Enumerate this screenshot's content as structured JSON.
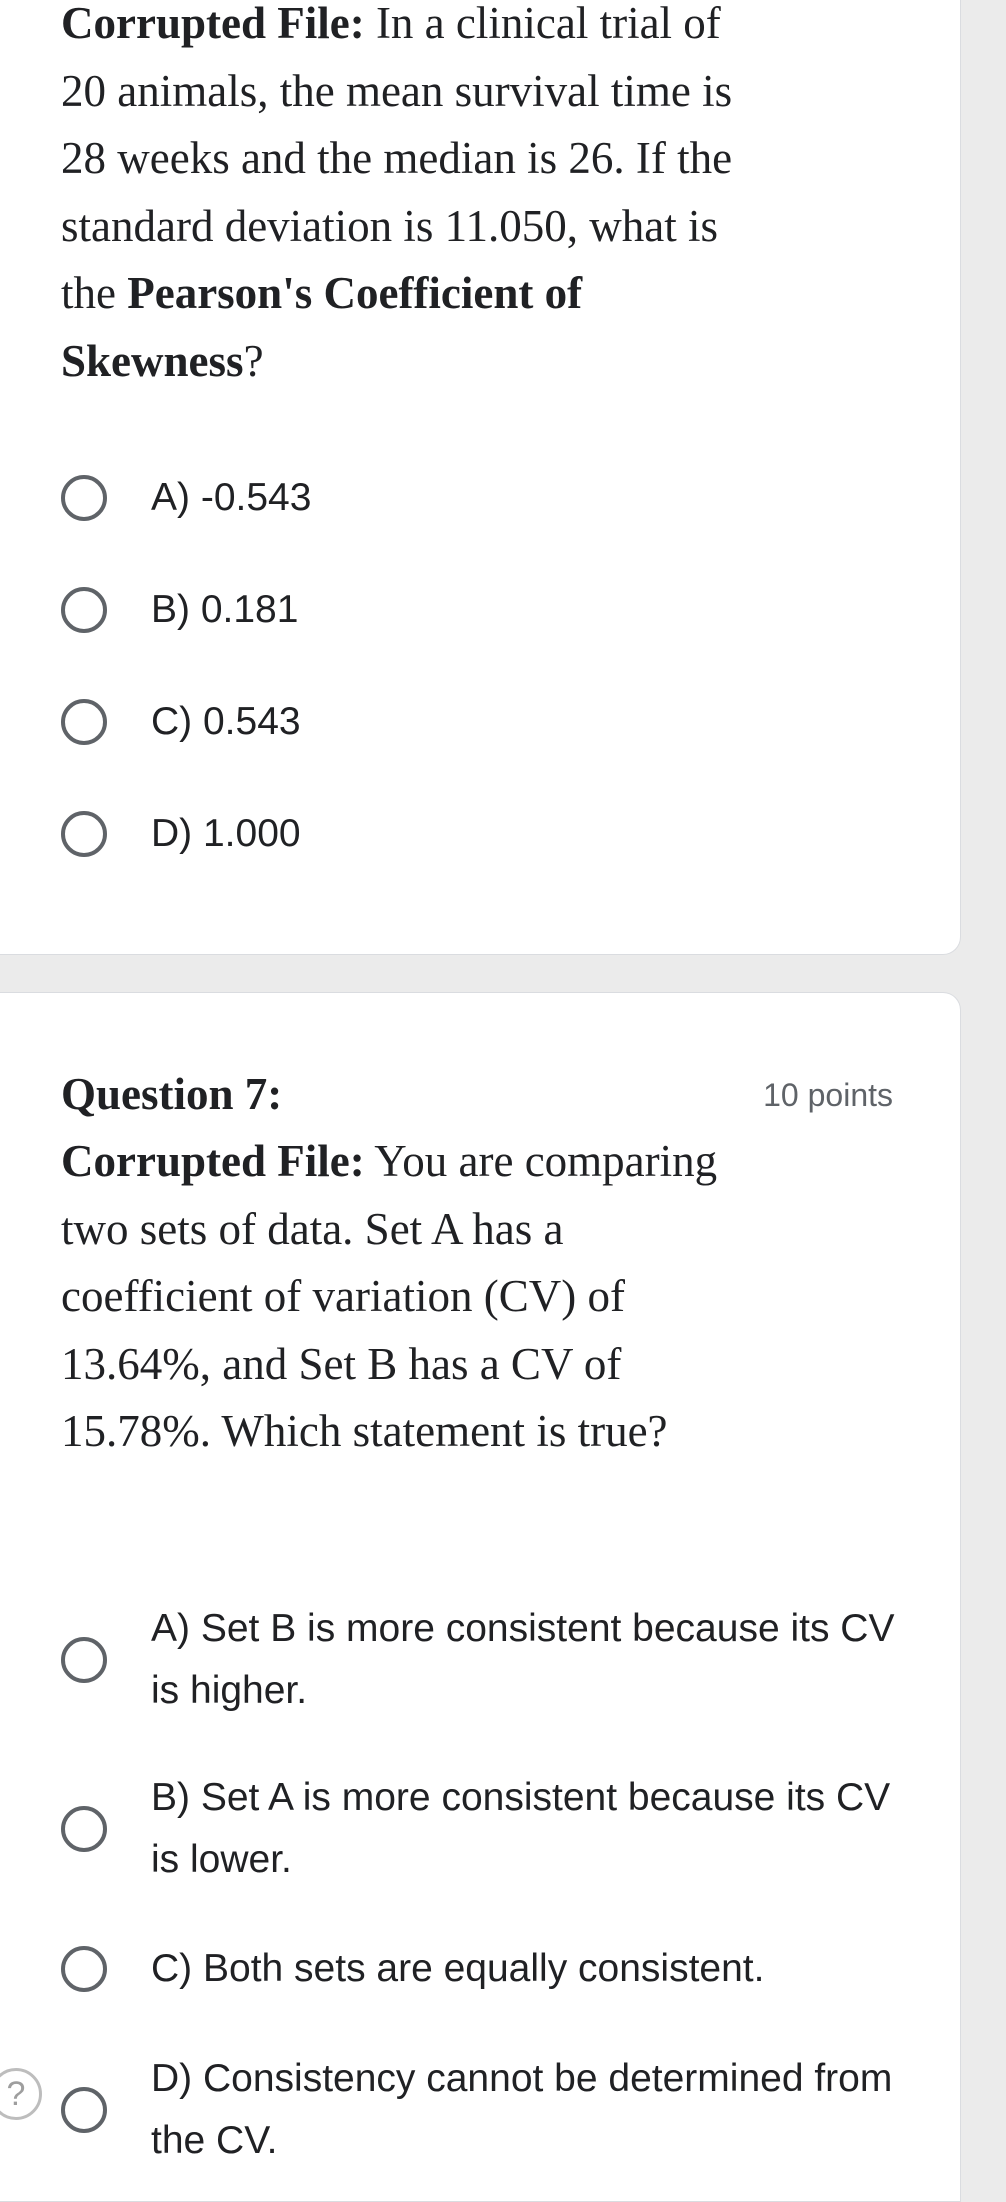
{
  "question6": {
    "text_prefix_bold": "Corrupted File:",
    "text_1": " In a clinical trial of 20 animals, the mean survival time is 28 weeks and the median is 26. If the standard deviation is 11.050, what is the ",
    "text_bold_2": "Pearson's Coefficient of Skewness",
    "text_3": "?",
    "options": [
      {
        "label": "A) -0.543"
      },
      {
        "label": "B) 0.181"
      },
      {
        "label": "C) 0.543"
      },
      {
        "label": "D) 1.000"
      }
    ]
  },
  "question7": {
    "title": "Question 7:",
    "points": "10 points",
    "text_prefix_bold": "Corrupted File:",
    "text_1": " You are comparing two sets of data. Set A has a coefficient of variation (CV) of 13.64%, and Set B has a CV of 15.78%. Which statement is true?",
    "options": [
      {
        "label": "A) Set B is more consistent because its CV is higher."
      },
      {
        "label": "B) Set A is more consistent because its CV is lower."
      },
      {
        "label": "C) Both sets are equally consistent."
      },
      {
        "label": "D) Consistency cannot be determined from the CV."
      }
    ]
  },
  "help": {
    "glyph": "?"
  }
}
